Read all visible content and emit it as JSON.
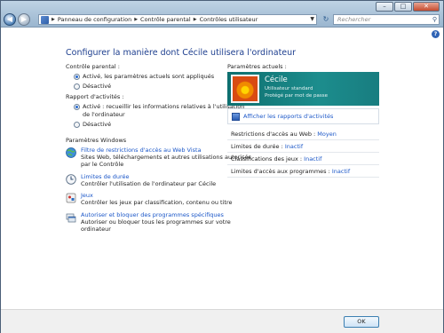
{
  "nav": {
    "breadcrumbs": [
      "Panneau de configuration",
      "Contrôle parental",
      "Contrôles utilisateur"
    ],
    "search_placeholder": "Rechercher",
    "icons": {
      "back": "back-arrow-icon",
      "forward": "forward-arrow-icon",
      "refresh": "refresh-icon",
      "search": "magnifier-icon",
      "help": "help-icon"
    }
  },
  "main": {
    "heading": "Configurer la manière dont Cécile utilisera l'ordinateur",
    "parental_control": {
      "label": "Contrôle parental :",
      "options": [
        {
          "label": "Activé, les paramètres actuels sont appliqués",
          "selected": true
        },
        {
          "label": "Désactivé",
          "selected": false
        }
      ]
    },
    "activity_report": {
      "label": "Rapport d'activités :",
      "options": [
        {
          "label": "Activé : recueillir les informations relatives à l'utilisation",
          "label2": "de l'ordinateur",
          "selected": true
        },
        {
          "label": "Désactivé",
          "selected": false
        }
      ]
    },
    "windows_settings": {
      "label": "Paramètres Windows",
      "items": [
        {
          "title": "Filtre de restrictions d'accès au Web Vista",
          "desc1": "Sites Web, téléchargements et autres utilisations autorisés",
          "desc2": "par le Contrôle",
          "icon": "globe-icon"
        },
        {
          "title": "Limites de durée",
          "desc1": "Contrôler l'utilisation de l'ordinateur par Cécile",
          "icon": "clock-icon"
        },
        {
          "title": "Jeux",
          "desc1": "Contrôler les jeux par classification, contenu ou titre",
          "icon": "games-icon"
        },
        {
          "title": "Autoriser et bloquer des programmes spécifiques",
          "desc1": "Autoriser ou bloquer tous les programmes sur votre",
          "desc2": "ordinateur",
          "icon": "programs-icon"
        }
      ]
    }
  },
  "current": {
    "label": "Paramètres actuels :",
    "user": {
      "name": "Cécile",
      "type": "Utilisateur standard",
      "password": "Protégé par mot de passe"
    },
    "reports_link": "Afficher les rapports d'activités",
    "stats": [
      {
        "label": "Restrictions d'accès au Web :",
        "value": "Moyen"
      },
      {
        "label": "Limites de durée :",
        "value": "Inactif"
      },
      {
        "label": "Classifications des jeux :",
        "value": "Inactif"
      },
      {
        "label": "Limites d'accès aux programmes :",
        "value": "Inactif"
      }
    ]
  },
  "footer": {
    "ok": "OK"
  },
  "colors": {
    "heading": "#1e3f8f",
    "link": "#1b57c8",
    "user_card": "#1c8d8d"
  }
}
